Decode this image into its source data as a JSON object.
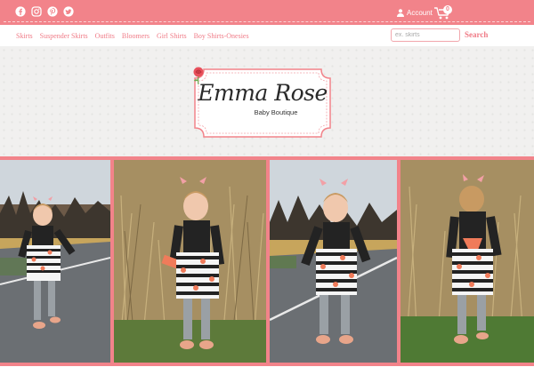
{
  "topbar": {
    "social_icons": [
      "facebook-icon",
      "instagram-icon",
      "pinterest-icon",
      "twitter-icon"
    ],
    "account_label": "Account",
    "cart_count": "0"
  },
  "nav": {
    "links": [
      "Skirts",
      "Suspender Skirts",
      "Outfits",
      "Bloomers",
      "Girl Shirts",
      "Boy Shirts-Onesies"
    ],
    "search_placeholder": "ex. skirts",
    "search_button": "Search"
  },
  "logo": {
    "name": "Emma Rose",
    "subtitle": "Baby Boutique"
  },
  "colors": {
    "brand_pink": "#f2838a",
    "link_pink": "#f07b87",
    "hero_bg": "#f1f0ef"
  },
  "photos": [
    "girl-running-road",
    "girl-dry-grass-front",
    "girl-laughing-road",
    "girl-back-view-grass"
  ]
}
